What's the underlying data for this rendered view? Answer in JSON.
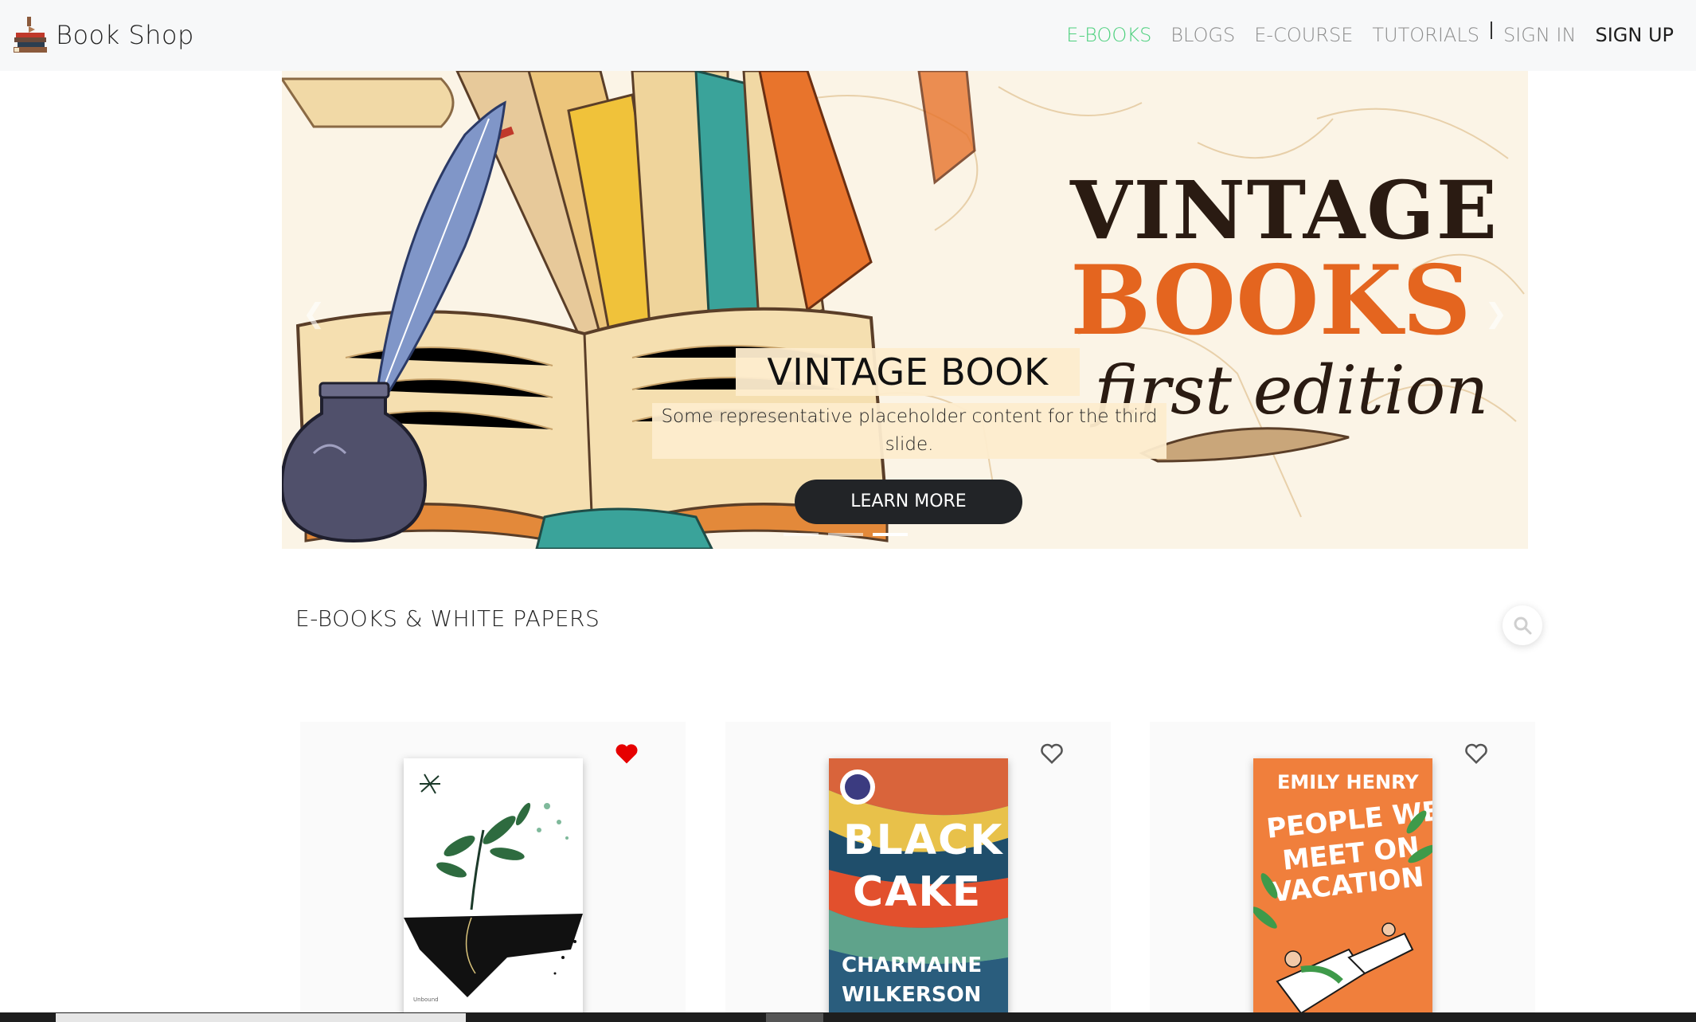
{
  "navbar": {
    "brand": "Book Shop",
    "links": [
      {
        "label": "E-BOOKS",
        "active": true
      },
      {
        "label": "BLOGS"
      },
      {
        "label": "E-COURSE"
      },
      {
        "label": "TUTORIALS"
      },
      {
        "label": "SIGN IN"
      },
      {
        "label": "SIGN UP"
      }
    ]
  },
  "carousel": {
    "title": "VINTAGE BOOK",
    "text": "Some representative placeholder content for the third slide.",
    "button": "LEARN MORE",
    "active_slide": 3,
    "slide_count": 3,
    "art_title_1": "VINTAGE",
    "art_title_2": "BOOKS",
    "art_title_3": "first edition"
  },
  "section": {
    "title": "E-BOOKS & WHITE PAPERS"
  },
  "books": [
    {
      "title": "Unbound",
      "favorited": true
    },
    {
      "title": "BLACK CAKE",
      "author": "CHARMAINE WILKERSON",
      "favorited": false
    },
    {
      "title": "PEOPLE WE MEET ON VACATION",
      "author": "EMILY HENRY",
      "favorited": false
    }
  ],
  "colors": {
    "accent": "#4cd07d",
    "heart": "#e60000",
    "button": "#222427",
    "caption_bg": "#fdeccd"
  }
}
